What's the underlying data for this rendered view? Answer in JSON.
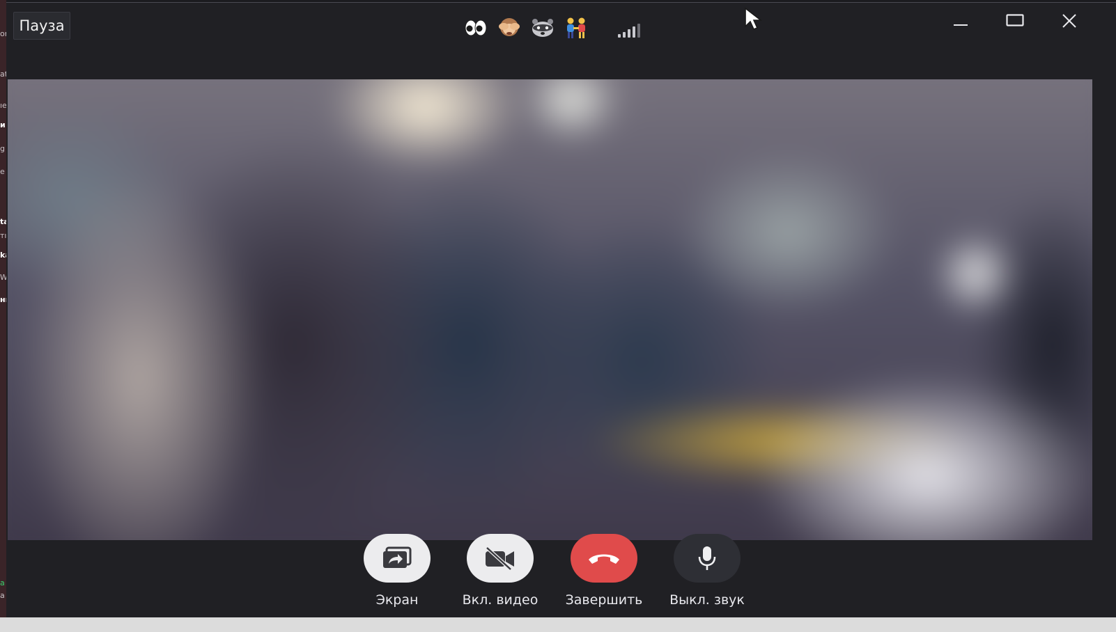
{
  "titlebar": {
    "pause_label": "Пауза",
    "emojis": [
      "👀",
      "🙈",
      "🦝",
      "👫"
    ],
    "signal_icon": "signal-bars-icon",
    "window_controls": [
      "minimize-icon",
      "maximize-icon",
      "close-icon"
    ]
  },
  "controls": {
    "screen": {
      "label": "Экран",
      "icon": "screen-share-icon"
    },
    "video": {
      "label": "Вкл. видео",
      "icon": "video-off-icon"
    },
    "end": {
      "label": "Завершить",
      "icon": "hang-up-icon"
    },
    "mute": {
      "label": "Выкл. звук",
      "icon": "microphone-icon"
    }
  },
  "colors": {
    "window_bg": "#202024",
    "end_call": "#e04b4b",
    "button_light": "#ececee",
    "button_dark": "#2e2f35"
  }
}
